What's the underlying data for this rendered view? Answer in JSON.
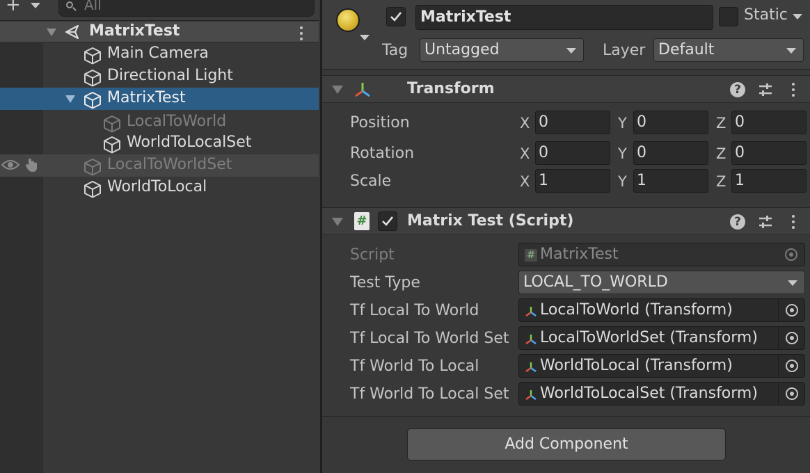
{
  "hierarchy": {
    "search_placeholder": "All",
    "scene": {
      "name": "MatrixTest"
    },
    "items": [
      {
        "label": "Main Camera"
      },
      {
        "label": "Directional Light"
      },
      {
        "label": "MatrixTest"
      },
      {
        "label": "LocalToWorld"
      },
      {
        "label": "WorldToLocalSet"
      },
      {
        "label": "LocalToWorldSet"
      },
      {
        "label": "WorldToLocal"
      }
    ]
  },
  "inspector": {
    "object_name": "MatrixTest",
    "static_label": "Static",
    "tag_label": "Tag",
    "tag_value": "Untagged",
    "layer_label": "Layer",
    "layer_value": "Default",
    "transform": {
      "title": "Transform",
      "rows": [
        {
          "label": "Position",
          "x": "0",
          "y": "0",
          "z": "0"
        },
        {
          "label": "Rotation",
          "x": "0",
          "y": "0",
          "z": "0"
        },
        {
          "label": "Scale",
          "x": "1",
          "y": "1",
          "z": "1"
        }
      ],
      "axis_x": "X",
      "axis_y": "Y",
      "axis_z": "Z"
    },
    "script": {
      "title": "Matrix Test (Script)",
      "script_label": "Script",
      "script_value": "MatrixTest",
      "test_type_label": "Test Type",
      "test_type_value": "LOCAL_TO_WORLD",
      "fields": [
        {
          "label": "Tf Local To World",
          "value": "LocalToWorld (Transform)"
        },
        {
          "label": "Tf Local To World Set",
          "value": "LocalToWorldSet (Transform)"
        },
        {
          "label": "Tf World To Local",
          "value": "WorldToLocal (Transform)"
        },
        {
          "label": "Tf World To Local Set",
          "value": "WorldToLocalSet (Transform)"
        }
      ]
    },
    "add_component_label": "Add Component"
  },
  "colors": {
    "selection": "#2c5d87",
    "panel": "#383838",
    "accent_gizmo_red": "#e0553c",
    "accent_gizmo_green": "#7ed04b",
    "accent_gizmo_blue": "#4aa8f0"
  }
}
